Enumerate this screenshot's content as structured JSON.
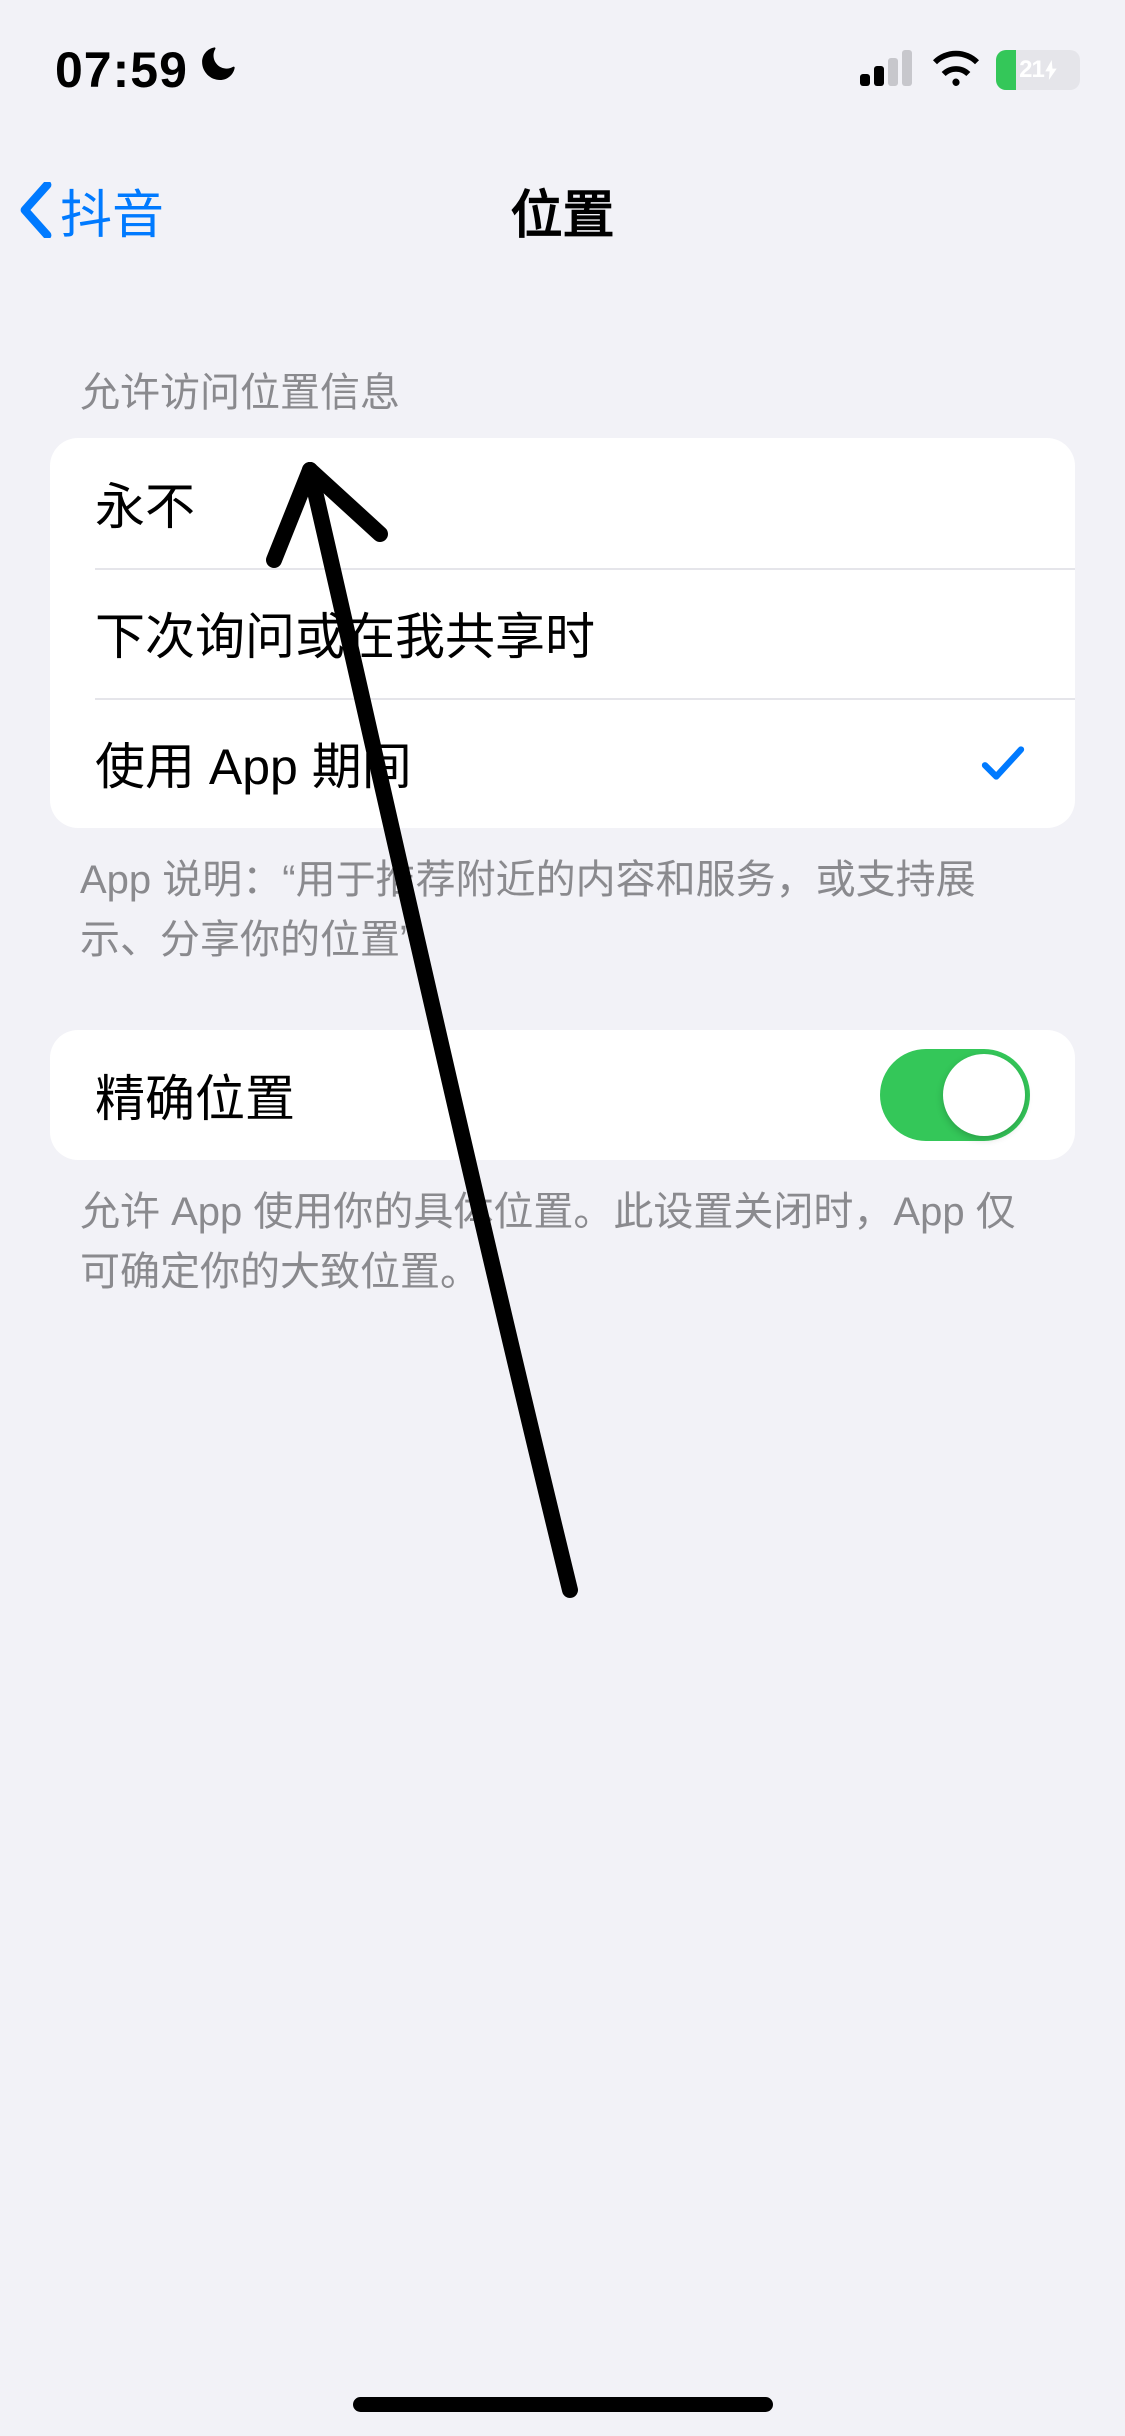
{
  "status": {
    "time": "07:59",
    "battery_text": "21"
  },
  "nav": {
    "back_label": "抖音",
    "title": "位置"
  },
  "location_access": {
    "header": "允许访问位置信息",
    "options": {
      "never": "永不",
      "ask": "下次询问或在我共享时",
      "while_using": "使用 App 期间"
    },
    "selected": "while_using",
    "footer": "App 说明：“用于推荐附近的内容和服务，或支持展示、分享你的位置”"
  },
  "precise": {
    "label": "精确位置",
    "on": true,
    "footer": "允许 App 使用你的具体位置。此设置关闭时，App 仅可确定你的大致位置。"
  }
}
